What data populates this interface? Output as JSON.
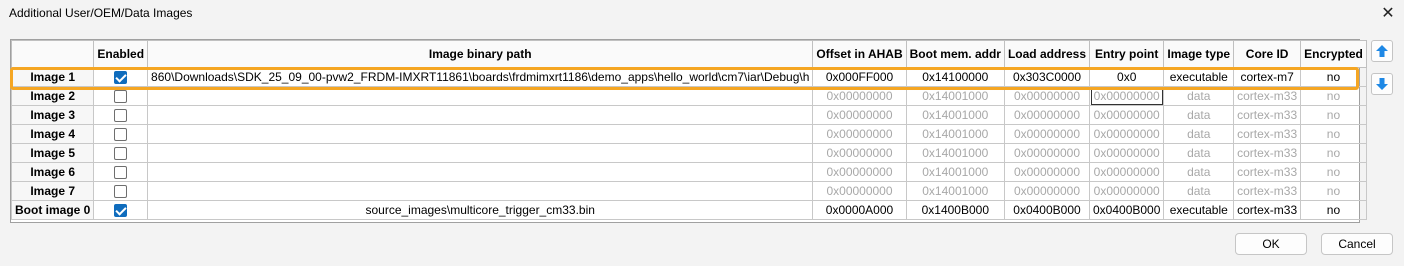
{
  "window": {
    "title": "Additional User/OEM/Data Images",
    "close_glyph": "✕"
  },
  "columns": [
    "",
    "Enabled",
    "Image binary path",
    "Offset in AHAB",
    "Boot mem. addr",
    "Load address",
    "Entry point",
    "Image type",
    "Core ID",
    "Encrypted"
  ],
  "rows": [
    {
      "name": "Image 1",
      "enabled": true,
      "disabled": false,
      "path": "860\\Downloads\\SDK_25_09_00-pvw2_FRDM-IMXRT11861\\boards\\frdmimxrt1186\\demo_apps\\hello_world\\cm7\\iar\\Debug\\h",
      "offset": "0x000FF000",
      "boot_mem": "0x14100000",
      "load": "0x303C0000",
      "entry": "0x0",
      "type": "executable",
      "core": "cortex-m7",
      "encrypted": "no"
    },
    {
      "name": "Image 2",
      "enabled": false,
      "disabled": true,
      "path": "",
      "offset": "0x00000000",
      "boot_mem": "0x14001000",
      "load": "0x00000000",
      "entry": "0x00000000",
      "type": "data",
      "core": "cortex-m33",
      "encrypted": "no"
    },
    {
      "name": "Image 3",
      "enabled": false,
      "disabled": true,
      "path": "",
      "offset": "0x00000000",
      "boot_mem": "0x14001000",
      "load": "0x00000000",
      "entry": "0x00000000",
      "type": "data",
      "core": "cortex-m33",
      "encrypted": "no"
    },
    {
      "name": "Image 4",
      "enabled": false,
      "disabled": true,
      "path": "",
      "offset": "0x00000000",
      "boot_mem": "0x14001000",
      "load": "0x00000000",
      "entry": "0x00000000",
      "type": "data",
      "core": "cortex-m33",
      "encrypted": "no"
    },
    {
      "name": "Image 5",
      "enabled": false,
      "disabled": true,
      "path": "",
      "offset": "0x00000000",
      "boot_mem": "0x14001000",
      "load": "0x00000000",
      "entry": "0x00000000",
      "type": "data",
      "core": "cortex-m33",
      "encrypted": "no"
    },
    {
      "name": "Image 6",
      "enabled": false,
      "disabled": true,
      "path": "",
      "offset": "0x00000000",
      "boot_mem": "0x14001000",
      "load": "0x00000000",
      "entry": "0x00000000",
      "type": "data",
      "core": "cortex-m33",
      "encrypted": "no"
    },
    {
      "name": "Image 7",
      "enabled": false,
      "disabled": true,
      "path": "",
      "offset": "0x00000000",
      "boot_mem": "0x14001000",
      "load": "0x00000000",
      "entry": "0x00000000",
      "type": "data",
      "core": "cortex-m33",
      "encrypted": "no"
    },
    {
      "name": "Boot image 0",
      "enabled": true,
      "disabled": false,
      "path": "source_images\\multicore_trigger_cm33.bin",
      "offset": "0x0000A000",
      "boot_mem": "0x1400B000",
      "load": "0x0400B000",
      "entry": "0x0400B000",
      "type": "executable",
      "core": "cortex-m33",
      "encrypted": "no"
    }
  ],
  "side_buttons": {
    "up_icon": "arrow-up-icon",
    "down_icon": "arrow-down-icon"
  },
  "buttons": {
    "ok": "OK",
    "cancel": "Cancel"
  },
  "colors": {
    "accent": "#0f6cbd",
    "highlight": "#f5a623",
    "disabled_text": "#a8a8a8"
  }
}
